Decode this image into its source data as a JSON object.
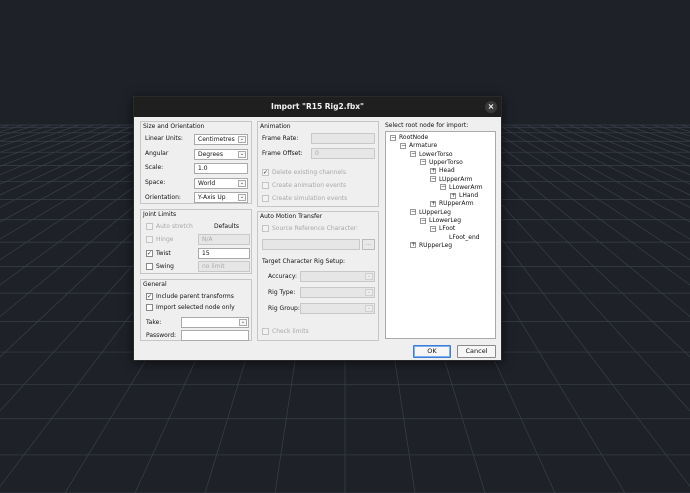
{
  "dialog": {
    "title": "Import \"R15 Rig2.fbx\"",
    "close_glyph": "×"
  },
  "size_orientation": {
    "title": "Size and Orientation",
    "linear_units_label": "Linear Units:",
    "linear_units_value": "Centimetres",
    "angular_label": "Angular",
    "angular_value": "Degrees",
    "scale_label": "Scale:",
    "scale_value": "1.0",
    "space_label": "Space:",
    "space_value": "World",
    "orientation_label": "Orientation:",
    "orientation_value": "Y-Axis Up"
  },
  "joint_limits": {
    "title": "Joint Limits",
    "auto_stretch_label": "Auto stretch",
    "defaults_label": "Defaults",
    "hinge_label": "Hinge",
    "hinge_value": "N/A",
    "twist_label": "Twist",
    "twist_value": "15",
    "swing_label": "Swing",
    "swing_placeholder": "no limit"
  },
  "general": {
    "title": "General",
    "include_parent_label": "Include parent transforms",
    "import_selected_label": "Import selected node only",
    "take_label": "Take:",
    "take_value": "",
    "password_label": "Password:",
    "password_value": ""
  },
  "animation": {
    "title": "Animation",
    "frame_rate_label": "Frame Rate:",
    "frame_rate_value": "",
    "frame_offset_label": "Frame Offset:",
    "frame_offset_value": "0",
    "delete_channels_label": "Delete existing channels",
    "create_anim_events_label": "Create animation events",
    "create_sim_events_label": "Create simulation events"
  },
  "auto_motion": {
    "title": "Auto Motion Transfer",
    "source_ref_label": "Source Reference Character:",
    "source_ref_value": "",
    "browse_label": "...",
    "target_setup_label": "Target Character Rig Setup:",
    "accuracy_label": "Accuracy:",
    "rig_type_label": "Rig Type:",
    "rig_group_label": "Rig Group:",
    "check_limits_label": "Check limits"
  },
  "root_node": {
    "label": "Select root node for import:",
    "nodes": [
      {
        "text": "RootNode",
        "exp": "−"
      },
      {
        "text": "Armature",
        "exp": "−"
      },
      {
        "text": "LowerTorso",
        "exp": "−"
      },
      {
        "text": "UpperTorso",
        "exp": "−"
      },
      {
        "text": "Head",
        "exp": "+"
      },
      {
        "text": "LUpperArm",
        "exp": "−"
      },
      {
        "text": "LLowerArm",
        "exp": "−"
      },
      {
        "text": "LHand",
        "exp": "+"
      },
      {
        "text": "RUpperArm",
        "exp": "+"
      },
      {
        "text": "LUpperLeg",
        "exp": "−"
      },
      {
        "text": "LLowerLeg",
        "exp": "−"
      },
      {
        "text": "LFoot",
        "exp": "−"
      },
      {
        "text": "LFoot_end",
        "exp": ""
      },
      {
        "text": "RUpperLeg",
        "exp": "+"
      }
    ]
  },
  "buttons": {
    "ok_label": "OK",
    "cancel_label": "Cancel"
  },
  "glyphs": {
    "check": "✓",
    "dropdown": "⌄"
  },
  "colors": {
    "background": "#1e2128",
    "grid_line": "#3a3f4a",
    "dialog_bg": "#efefef",
    "titlebar": "#1f1f1f",
    "ok_border": "#3c7dd8"
  }
}
